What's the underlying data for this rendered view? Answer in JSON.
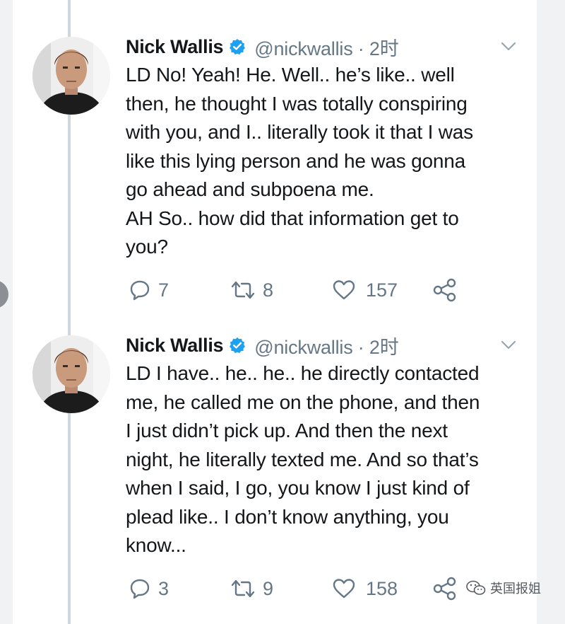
{
  "top_fragment": "",
  "tweets": [
    {
      "name": "Nick Wallis",
      "handle": "@nickwallis · 2时",
      "text_lines": [
        "LD No! Yeah! He. Well.. he’s like.. well",
        "then, he thought I was totally conspiring",
        "with you, and I.. literally took it that I was",
        "like this lying person and he was gonna",
        "go ahead and subpoena me.",
        "AH So.. how did that information get to",
        "you?"
      ],
      "replies": "7",
      "retweets": "8",
      "likes": "157"
    },
    {
      "name": "Nick Wallis",
      "handle": "@nickwallis · 2时",
      "text_lines": [
        "LD I have.. he.. he.. he directly contacted",
        "me, he called me on the phone, and then",
        "I just didn’t pick up. And then the next",
        "night, he literally texted me. And so that’s",
        "when I said, I go, you know I just kind of",
        "plead like.. I don’t know anything, you",
        "know..."
      ],
      "replies": "3",
      "retweets": "9",
      "likes": "158"
    }
  ],
  "icons": {
    "verified": "verified-badge-icon",
    "caret": "chevron-down-icon",
    "reply": "reply-icon",
    "retweet": "retweet-icon",
    "like": "heart-icon",
    "share": "share-icon",
    "watermark": "wechat-icon"
  },
  "colors": {
    "verified": "#1da1f2",
    "meta": "#657786",
    "thread_line": "#cfd6dc"
  },
  "watermark": "英国报姐"
}
